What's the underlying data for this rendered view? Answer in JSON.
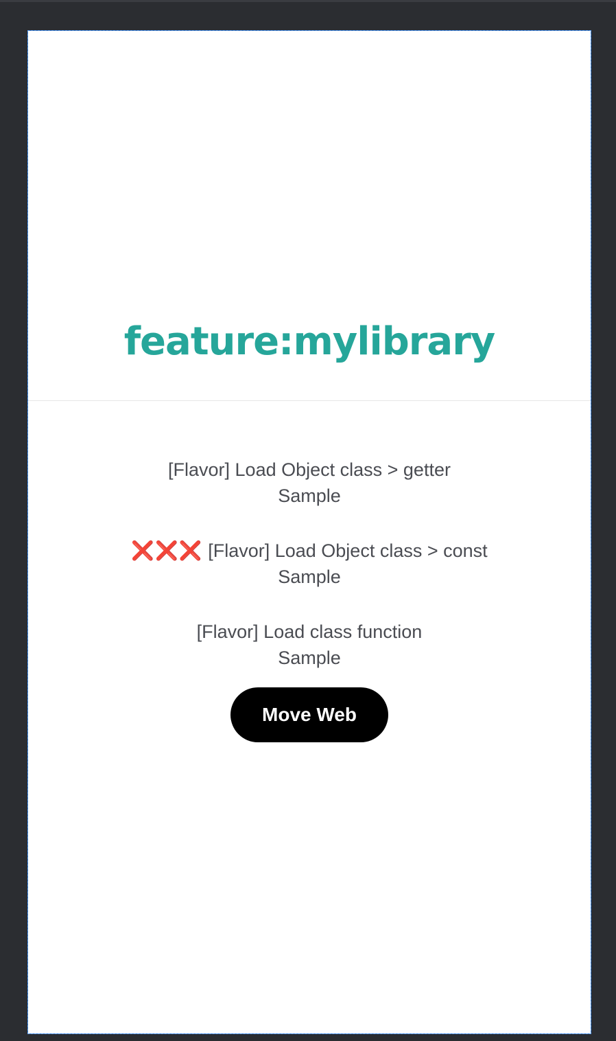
{
  "header": {
    "title": "feature:mylibrary",
    "title_color": "#26a69a"
  },
  "samples": [
    {
      "line1": "[Flavor] Load Object class > getter",
      "line2": "Sample",
      "status_marks": ""
    },
    {
      "line1": "[Flavor] Load Object class > const",
      "line2": "Sample",
      "status_marks": "❌❌❌"
    },
    {
      "line1": "[Flavor] Load class function",
      "line2": "Sample",
      "status_marks": ""
    }
  ],
  "actions": {
    "move_web_label": "Move Web"
  },
  "colors": {
    "background": "#2b2d31",
    "screen": "#ffffff",
    "button": "#000000",
    "error": "#e53935"
  }
}
